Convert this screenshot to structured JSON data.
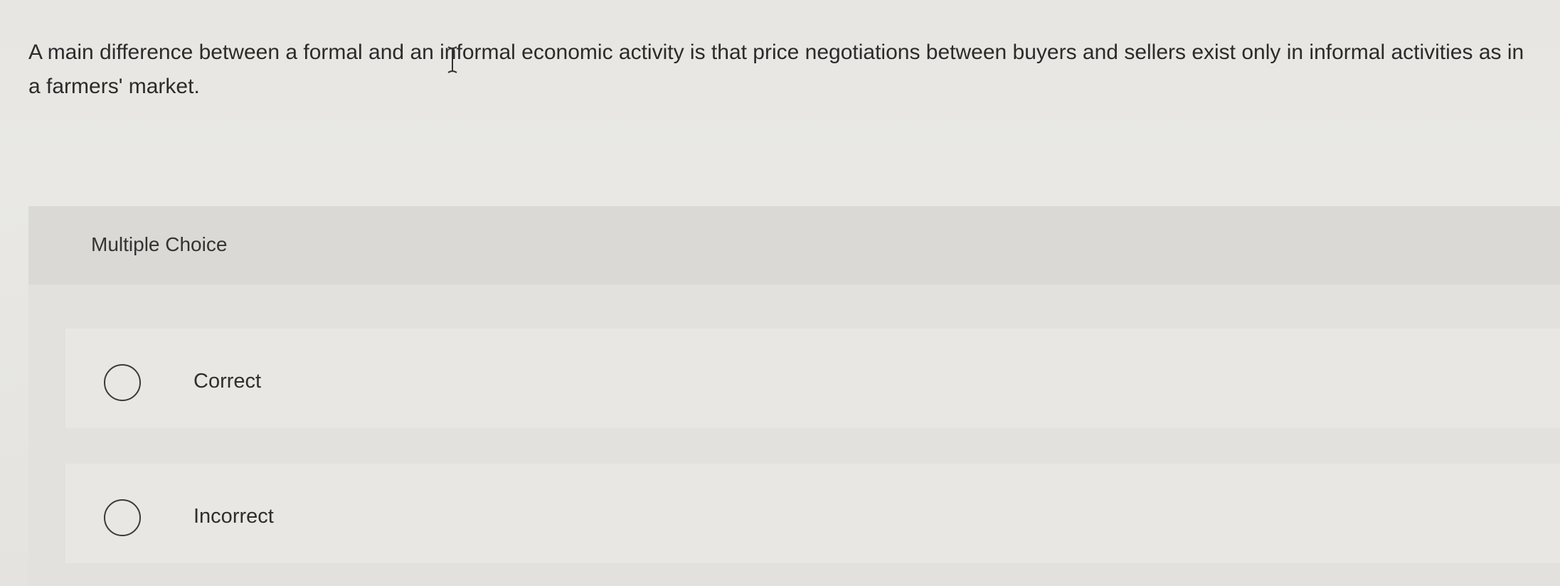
{
  "question": {
    "text": "A main difference between a formal and an informal economic activity is that price negotiations between buyers and sellers exist only in informal activities as in a farmers' market."
  },
  "question_type": {
    "label": "Multiple Choice"
  },
  "options": [
    {
      "label": "Correct",
      "selected": false
    },
    {
      "label": "Incorrect",
      "selected": false
    }
  ],
  "colors": {
    "page_background": "#e7e6e2",
    "header_band": "#dad9d5",
    "option_background": "#e8e7e3",
    "text": "#2b2b2b"
  }
}
